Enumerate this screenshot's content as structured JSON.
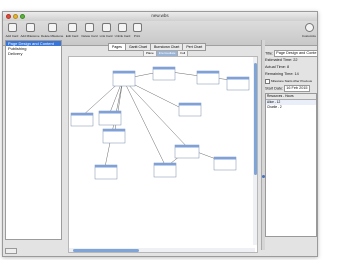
{
  "window": {
    "title": "new.wbs"
  },
  "toolbar": {
    "items": [
      {
        "label": "Add Card",
        "icon": "card-add-icon"
      },
      {
        "label": "Add Milestone",
        "icon": "milestone-add-icon"
      },
      {
        "label": "Delete Milestone",
        "icon": "milestone-delete-icon"
      },
      {
        "label": "Edit Card",
        "icon": "card-edit-icon"
      },
      {
        "label": "Delete Card",
        "icon": "card-delete-icon"
      },
      {
        "label": "Link Card",
        "icon": "link-icon"
      },
      {
        "label": "Unlink Card",
        "icon": "unlink-icon"
      },
      {
        "label": "Print",
        "icon": "printer-icon"
      },
      {
        "label": "Customize",
        "icon": "gear-icon"
      }
    ]
  },
  "sidebar": {
    "items": [
      {
        "label": "Page Design and Content",
        "selected": true
      },
      {
        "label": "Publishing",
        "selected": false
      },
      {
        "label": "Delivery",
        "selected": false
      }
    ]
  },
  "tabs": [
    {
      "label": "Pages",
      "selected": true
    },
    {
      "label": "Gantt Chart",
      "selected": false
    },
    {
      "label": "Burndown Chart",
      "selected": false
    },
    {
      "label": "Pert Chart",
      "selected": false
    }
  ],
  "zoom": {
    "buttons": [
      {
        "label": "Plane",
        "selected": false
      },
      {
        "label": "Intermediate",
        "selected": true
      },
      {
        "label": "Full",
        "selected": false
      }
    ]
  },
  "inspector": {
    "title_label": "Title:",
    "title_value": "Page Design and Conte",
    "estimated_time": "Estimated Time: 22",
    "actual_time": "Actual Time: 8",
    "remaining_time": "Remaining Time: 14",
    "milestone_checkbox_label": "Milestone Starts After Previous",
    "start_date_label": "Start Date:",
    "start_date_value": "16 Feb 2015",
    "table_header": "Resources - Hours",
    "table_rows": [
      "Alice - 12",
      "Charlie - 2"
    ]
  },
  "colors": {
    "selection": "#3875d7",
    "card_header": "#7fa0d8",
    "link_line": "#6a6a6a"
  }
}
